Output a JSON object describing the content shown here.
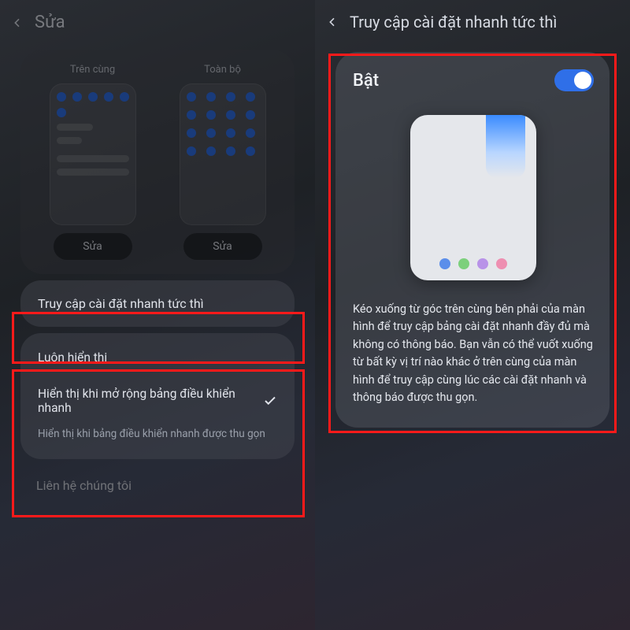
{
  "left": {
    "title": "Sửa",
    "preview": {
      "opt1_label": "Trên cùng",
      "opt2_label": "Toàn bộ",
      "edit_btn": "Sửa"
    },
    "quick_access_row": "Truy cập cài đặt nhanh tức thì",
    "options": {
      "opt1": "Luôn hiển thị",
      "opt2": "Hiển thị khi mở rộng bảng điều khiển nhanh",
      "opt2_sub": "Hiển thị khi bảng điều khiển nhanh được thu gọn"
    },
    "contact": "Liên hệ chúng tôi"
  },
  "right": {
    "title": "Truy cập cài đặt nhanh tức thì",
    "toggle_label": "Bật",
    "description": "Kéo xuống từ góc trên cùng bên phải của màn hình để truy cập bảng cài đặt nhanh đầy đủ mà không có thông báo. Bạn vẫn có thể vuốt xuống từ bất kỳ vị trí nào khác ở trên cùng của màn hình để truy cập cùng lúc các cài đặt nhanh và thông báo được thu gọn."
  }
}
